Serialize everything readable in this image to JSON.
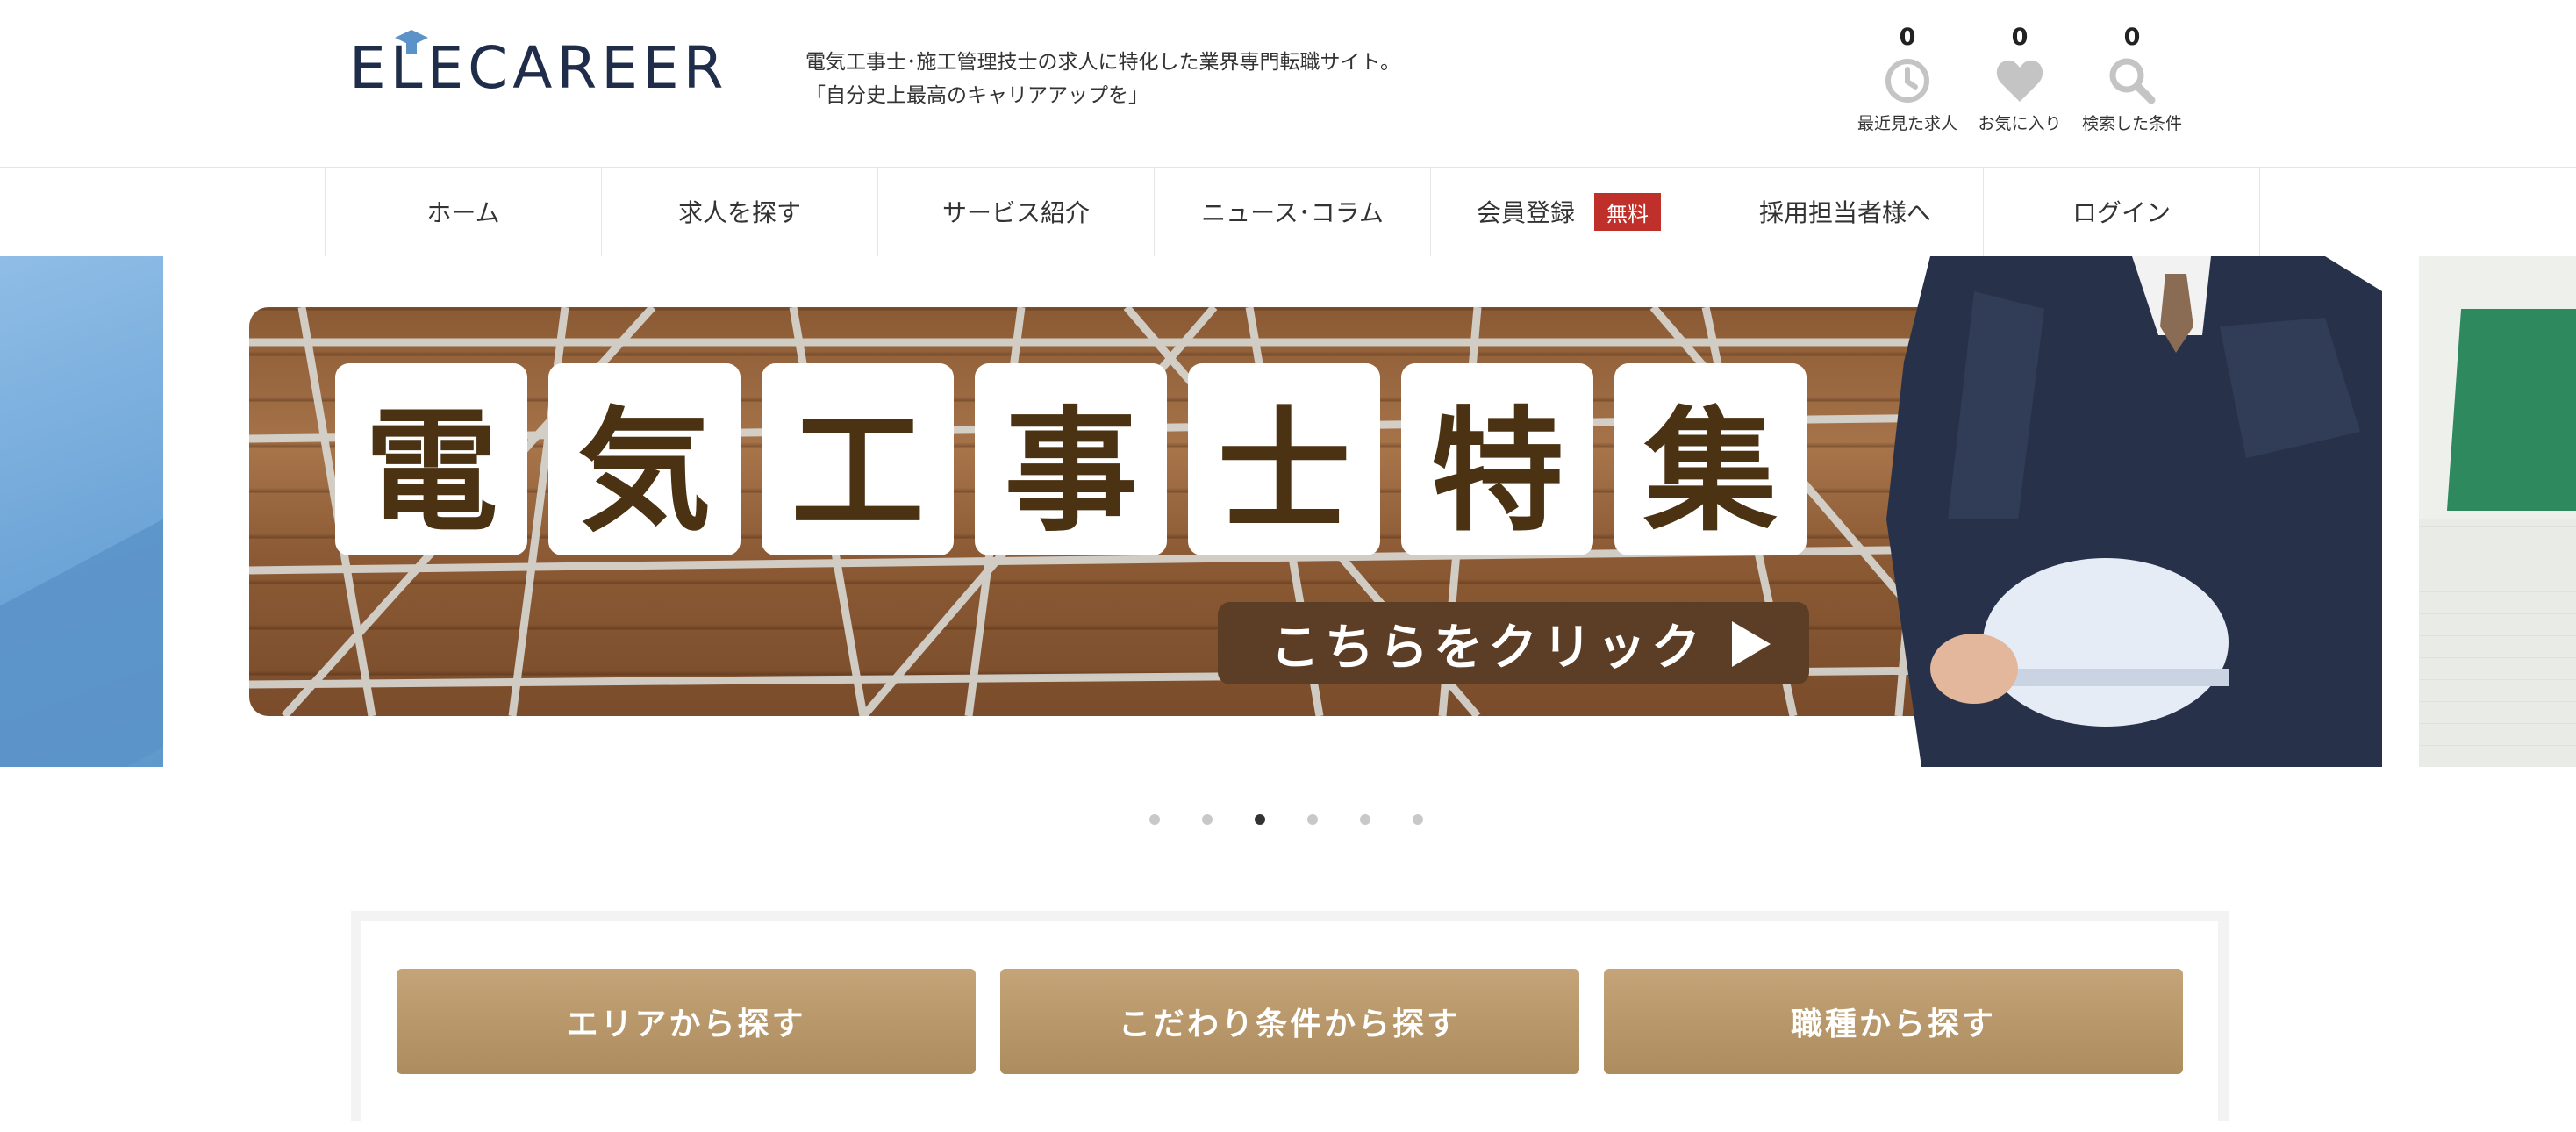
{
  "header": {
    "logo_text": "ELECAREER",
    "tagline_line1": "電気工事士･施工管理技士の求人に特化した業界専門転職サイト。",
    "tagline_line2": "「自分史上最高のキャリアアップを」",
    "counters": [
      {
        "count": "0",
        "label": "最近見た求人",
        "icon": "clock-icon"
      },
      {
        "count": "0",
        "label": "お気に入り",
        "icon": "heart-icon"
      },
      {
        "count": "0",
        "label": "検索した条件",
        "icon": "search-icon"
      }
    ]
  },
  "nav": {
    "items": [
      {
        "label": "ホーム"
      },
      {
        "label": "求人を探す"
      },
      {
        "label": "サービス紹介"
      },
      {
        "label": "ニュース･コラム"
      },
      {
        "label": "会員登録",
        "badge": "無料"
      },
      {
        "label": "採用担当者様へ"
      },
      {
        "label": "ログイン"
      }
    ]
  },
  "banner": {
    "title_chars": [
      "電",
      "気",
      "工",
      "事",
      "士",
      "特",
      "集"
    ],
    "cta_label": "こちらをクリック",
    "active_slide_index": 3,
    "slide_count": 6
  },
  "search": {
    "buttons": [
      {
        "label": "エリアから探す"
      },
      {
        "label": "こだわり条件から探す"
      },
      {
        "label": "職種から探す"
      }
    ]
  },
  "colors": {
    "brand_navy": "#1f2d4a",
    "brand_accent_blue": "#6fa3d6",
    "badge_red": "#c0302a",
    "search_gold": "#b8976a",
    "cta_brown": "#5c3e26"
  }
}
